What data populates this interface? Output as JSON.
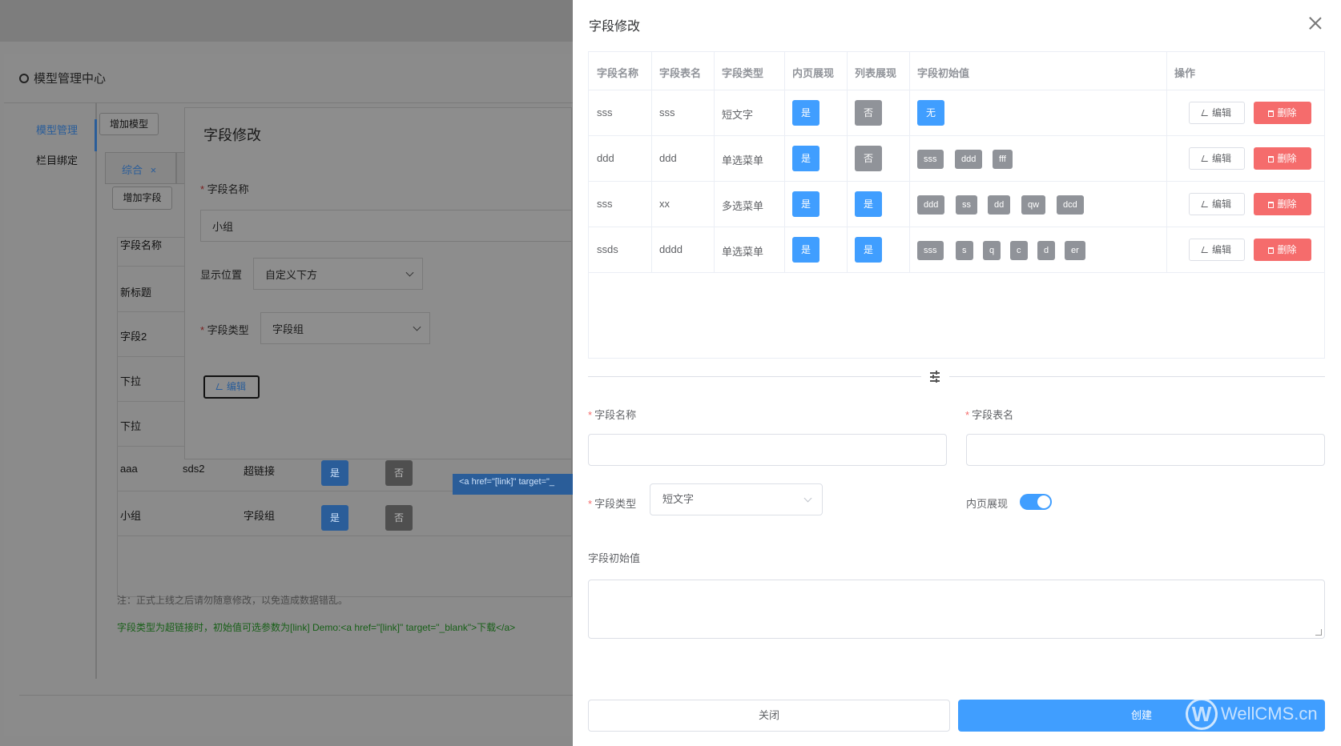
{
  "background": {
    "app_title": "模型管理中心",
    "sidebar": [
      "模型管理",
      "栏目绑定"
    ],
    "add_model_btn": "增加模型",
    "tab_label": "综合",
    "tab_close": "×",
    "add_field_btn": "增加字段",
    "table_header": "字段名称",
    "rows": [
      {
        "name": "新标题"
      },
      {
        "name": "字段2"
      },
      {
        "name": "下拉"
      },
      {
        "name": "下拉"
      },
      {
        "name": "aaa",
        "alias": "sds2",
        "type": "超链接",
        "show": "是",
        "list": "否",
        "init": "<a href=\"[link]\" target=\"_"
      },
      {
        "name": "小组",
        "type": "字段组",
        "show": "是",
        "list": "否"
      }
    ],
    "note1": "注：正式上线之后请勿随意修改，以免造成数据错乱。",
    "note2": "字段类型为超链接时，初始值可选参数为[link] Demo:<a href=\"[link]\" target=\"_blank\">下载</a>",
    "inner_dialog": {
      "title": "字段修改",
      "name_label": "字段名称",
      "name_value": "小组",
      "position_label": "显示位置",
      "position_value": "自定义下方",
      "type_label": "字段类型",
      "type_value": "字段组",
      "edit_btn": "编辑"
    }
  },
  "drawer": {
    "title": "字段修改",
    "table": {
      "headers": [
        "字段名称",
        "字段表名",
        "字段类型",
        "内页展现",
        "列表展现",
        "字段初始值",
        "操作"
      ],
      "rows": [
        {
          "name": "sss",
          "alias": "sss",
          "type": "短文字",
          "show": "是",
          "list": "否",
          "list_on": false,
          "init_chip": "无",
          "tags": []
        },
        {
          "name": "ddd",
          "alias": "ddd",
          "type": "单选菜单",
          "show": "是",
          "list": "否",
          "list_on": false,
          "init_chip": "",
          "tags": [
            "sss",
            "ddd",
            "fff"
          ]
        },
        {
          "name": "sss",
          "alias": "xx",
          "type": "多选菜单",
          "show": "是",
          "list": "是",
          "list_on": true,
          "init_chip": "",
          "tags": [
            "ddd",
            "ss",
            "dd",
            "qw",
            "dcd"
          ]
        },
        {
          "name": "ssds",
          "alias": "dddd",
          "type": "单选菜单",
          "show": "是",
          "list": "是",
          "list_on": true,
          "init_chip": "",
          "tags": [
            "sss",
            "s",
            "q",
            "c",
            "d",
            "er"
          ]
        }
      ],
      "edit_label": "编辑",
      "delete_label": "删除"
    },
    "form": {
      "name_label": "字段名称",
      "alias_label": "字段表名",
      "type_label": "字段类型",
      "type_value": "短文字",
      "show_label": "内页展现",
      "show_on": true,
      "init_label": "字段初始值"
    },
    "buttons": {
      "close": "关闭",
      "create": "创建"
    },
    "watermark": "WellCMS.cn"
  },
  "colors": {
    "primary": "#409eff",
    "danger": "#f56c6c",
    "info": "#909399"
  }
}
